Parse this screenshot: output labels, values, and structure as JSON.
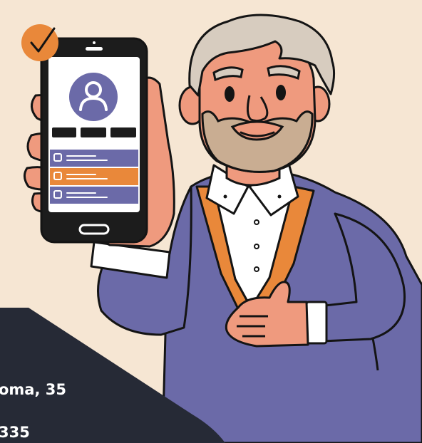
{
  "overlay": {
    "address_text": "oma, 35",
    "phone_text": "335"
  },
  "colors": {
    "background": "#f6e6d3",
    "sweater": "#6b6aa8",
    "accent_orange": "#e9883a",
    "skin": "#ef9a7e",
    "hair": "#d7ccbf",
    "beard": "#c9ad92",
    "dark_panel": "#262a36",
    "outline": "#141414"
  },
  "icons": {
    "phone_badge": "checkmark-icon",
    "phone_avatar": "user-profile-icon"
  }
}
